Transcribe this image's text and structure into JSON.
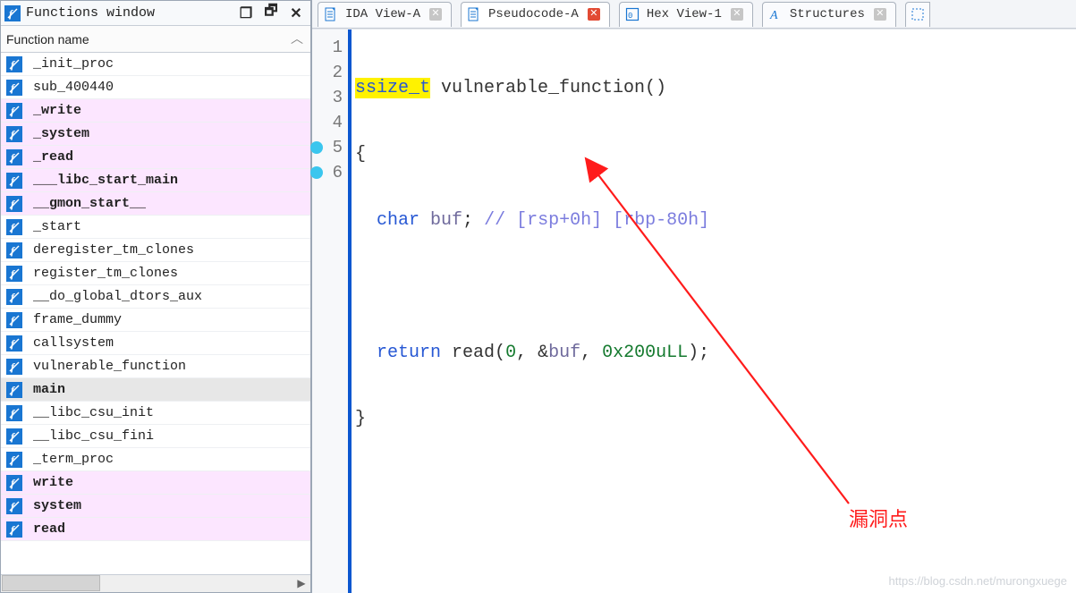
{
  "functions_window": {
    "title": "Functions window",
    "header": "Function name",
    "items": [
      {
        "name": "_init_proc",
        "pink": false,
        "bold": false
      },
      {
        "name": "sub_400440",
        "pink": false,
        "bold": false
      },
      {
        "name": "_write",
        "pink": true,
        "bold": true
      },
      {
        "name": "_system",
        "pink": true,
        "bold": true
      },
      {
        "name": "_read",
        "pink": true,
        "bold": true
      },
      {
        "name": "___libc_start_main",
        "pink": true,
        "bold": true
      },
      {
        "name": "__gmon_start__",
        "pink": true,
        "bold": true
      },
      {
        "name": "_start",
        "pink": false,
        "bold": false
      },
      {
        "name": "deregister_tm_clones",
        "pink": false,
        "bold": false
      },
      {
        "name": "register_tm_clones",
        "pink": false,
        "bold": false
      },
      {
        "name": "__do_global_dtors_aux",
        "pink": false,
        "bold": false
      },
      {
        "name": "frame_dummy",
        "pink": false,
        "bold": false
      },
      {
        "name": "callsystem",
        "pink": false,
        "bold": false
      },
      {
        "name": "vulnerable_function",
        "pink": false,
        "bold": false
      },
      {
        "name": "main",
        "pink": false,
        "bold": true,
        "selected": true
      },
      {
        "name": "__libc_csu_init",
        "pink": false,
        "bold": false
      },
      {
        "name": "__libc_csu_fini",
        "pink": false,
        "bold": false
      },
      {
        "name": "_term_proc",
        "pink": false,
        "bold": false
      },
      {
        "name": "write",
        "pink": true,
        "bold": true
      },
      {
        "name": "system",
        "pink": true,
        "bold": true
      },
      {
        "name": "read",
        "pink": true,
        "bold": true
      }
    ]
  },
  "tabs": [
    {
      "label": "IDA View-A",
      "icon": "doc",
      "active": false,
      "close": "gray"
    },
    {
      "label": "Pseudocode-A",
      "icon": "doc",
      "active": true,
      "close": "red"
    },
    {
      "label": "Hex View-1",
      "icon": "hex",
      "active": false,
      "close": "gray"
    },
    {
      "label": "Structures",
      "icon": "struct",
      "active": false,
      "close": "gray"
    }
  ],
  "code": {
    "lines": [
      {
        "n": 1,
        "bp": false
      },
      {
        "n": 2,
        "bp": false
      },
      {
        "n": 3,
        "bp": false
      },
      {
        "n": 4,
        "bp": false
      },
      {
        "n": 5,
        "bp": true
      },
      {
        "n": 6,
        "bp": true
      }
    ],
    "content": {
      "l1_type": "ssize_t",
      "l1_func": " vulnerable_function()",
      "l2": "{",
      "l3_indent": "  ",
      "l3_kw": "char",
      "l3_var": " buf",
      "l3_punct": ";",
      "l3_cmt": " // [rsp+0h] [rbp-80h]",
      "l4": "",
      "l5_indent": "  ",
      "l5_kw": "return",
      "l5_func": " read",
      "l5_open": "(",
      "l5_arg0": "0",
      "l5_comma1": ", &",
      "l5_var": "buf",
      "l5_comma2": ", ",
      "l5_arg2": "0x200uLL",
      "l5_close": ");",
      "l6": "}"
    }
  },
  "annotation_label": "漏洞点",
  "watermark": "https://blog.csdn.net/murongxuege"
}
